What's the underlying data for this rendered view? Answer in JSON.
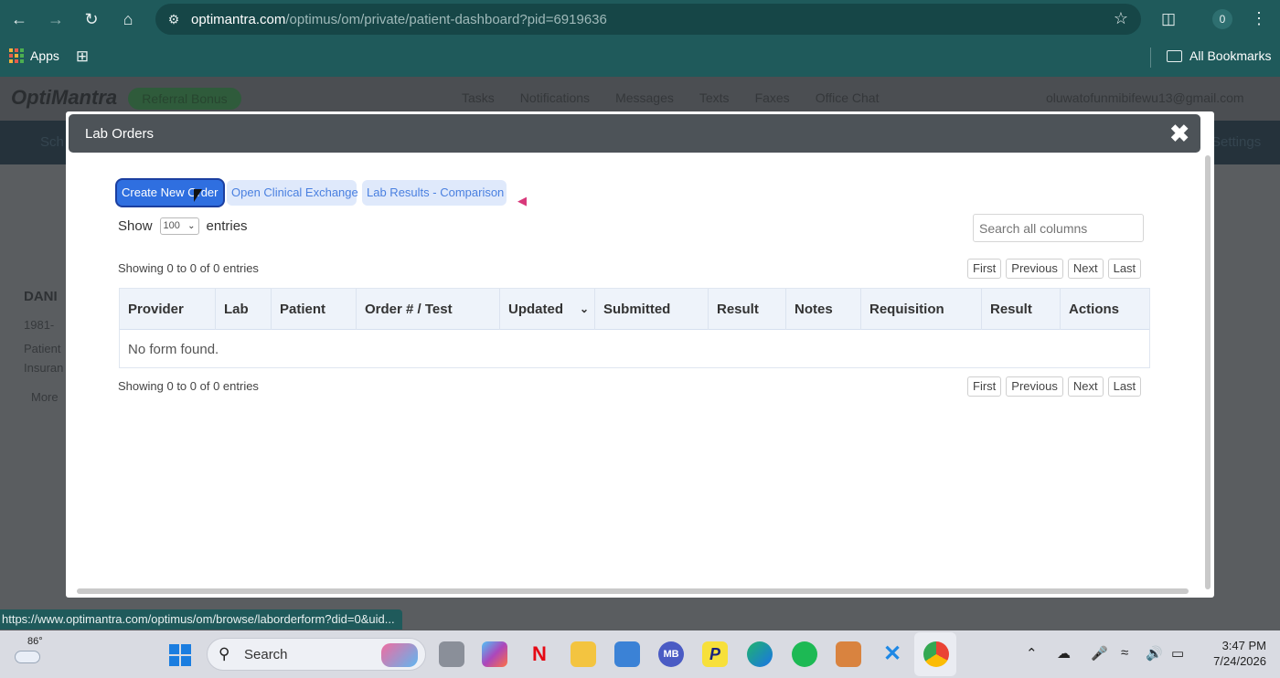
{
  "browser": {
    "url_host": "optimantra.com",
    "url_path": "/optimus/om/private/patient-dashboard?pid=6919636",
    "profile_initial": "0",
    "bookmarks": {
      "apps_label": "Apps",
      "all_bookmarks_label": "All Bookmarks"
    },
    "status_link": "https://www.optimantra.com/optimus/om/browse/laborderform?did=0&uid..."
  },
  "app": {
    "logo": "OptiMantra",
    "referral_label": "Referral Bonus",
    "nav": [
      "Tasks",
      "Notifications",
      "Messages",
      "Texts",
      "Faxes",
      "Office Chat"
    ],
    "user_email": "oluwatofunmibifewu13@gmail.com",
    "subbar_left": "Sch",
    "subbar_right": "Settings",
    "patient_partial": "DANI",
    "patient_lines": [
      "1981-",
      "Patient",
      "Insuran",
      "More"
    ]
  },
  "modal": {
    "title": "Lab Orders",
    "buttons": {
      "create": "Create New Order",
      "clinical_exchange": "Open Clinical Exchange",
      "comparison": "Lab Results - Comparison"
    },
    "show_label": "Show",
    "show_value": "100",
    "entries_label": "entries",
    "search_placeholder": "Search all columns",
    "info_top": "Showing 0 to 0 of 0 entries",
    "info_bottom": "Showing 0 to 0 of 0 entries",
    "pager": {
      "first": "First",
      "previous": "Previous",
      "next": "Next",
      "last": "Last"
    },
    "columns": [
      "Provider",
      "Lab",
      "Patient",
      "Order # / Test",
      "Updated",
      "Submitted",
      "Result",
      "Notes",
      "Requisition",
      "Result",
      "Actions"
    ],
    "empty_message": "No form found."
  },
  "taskbar": {
    "temperature": "86°",
    "search_label": "Search",
    "mb_label": "MB",
    "time": "3:47 PM",
    "date": "7/24/2026"
  },
  "colors": {
    "chrome": "#1f5a5b",
    "primary_button": "#2f6fe0",
    "light_button": "#dfe9fb",
    "modal_header": "#4d5358"
  }
}
